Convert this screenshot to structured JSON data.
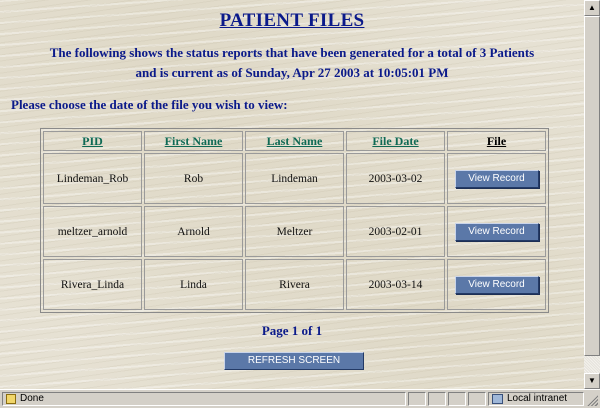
{
  "page": {
    "title": "PATIENT FILES",
    "status_line_1": "The following shows the status reports that have been generated for a total of 3 Patients",
    "status_line_2": "and is current as of Sunday, Apr 27 2003 at 10:05:01 PM",
    "prompt": "Please choose the date of the file you wish to view:",
    "pager": "Page 1 of 1",
    "refresh_label": "REFRESH SCREEN"
  },
  "table": {
    "headers": {
      "pid": "PID",
      "first_name": "First Name",
      "last_name": "Last Name",
      "file_date": "File Date",
      "file": "File"
    },
    "rows": [
      {
        "pid": "Lindeman_Rob",
        "first_name": "Rob",
        "last_name": "Lindeman",
        "file_date": "2003-03-02",
        "action": "View Record"
      },
      {
        "pid": "meltzer_arnold",
        "first_name": "Arnold",
        "last_name": "Meltzer",
        "file_date": "2003-02-01",
        "action": "View Record"
      },
      {
        "pid": "Rivera_Linda",
        "first_name": "Linda",
        "last_name": "Rivera",
        "file_date": "2003-03-14",
        "action": "View Record"
      }
    ]
  },
  "statusbar": {
    "status": "Done",
    "zone": "Local intranet",
    "status_icon": "page-done-icon",
    "zone_icon": "local-intranet-icon"
  },
  "colors": {
    "heading": "#0b1a8a",
    "header_link": "#0f6a55",
    "button": "#5b78a8"
  }
}
